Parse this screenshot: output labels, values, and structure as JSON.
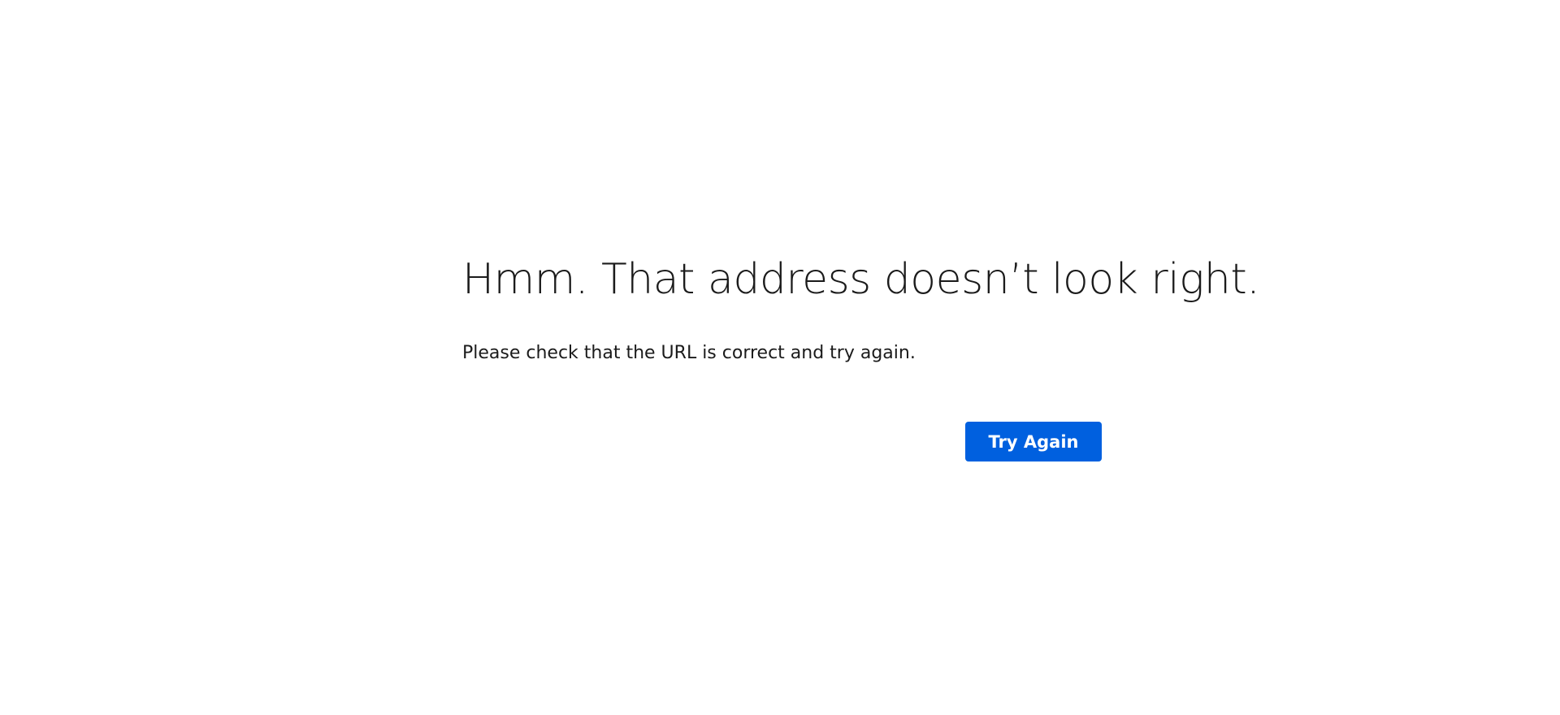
{
  "error": {
    "title": "Hmm. That address doesn’t look right.",
    "message": "Please check that the URL is correct and try again.",
    "button_label": "Try Again"
  },
  "colors": {
    "background": "#ffffff",
    "text": "#1b1b1b",
    "button_background": "#0060df",
    "button_text": "#ffffff"
  }
}
